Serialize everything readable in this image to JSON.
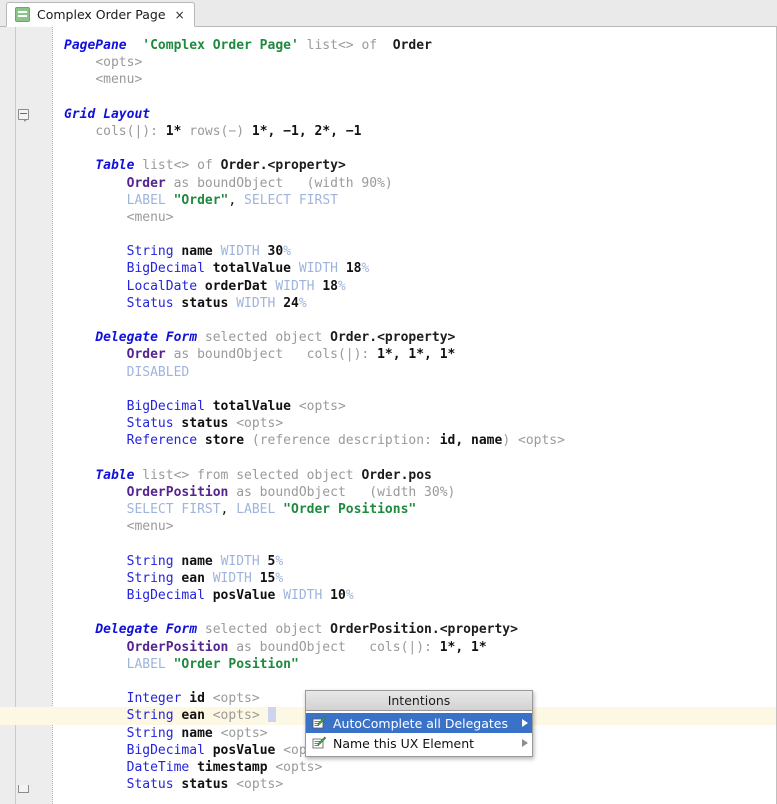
{
  "tab": {
    "icon": "page-green-icon",
    "label": "Complex Order Page",
    "close": "×"
  },
  "code": {
    "lines": [
      {
        "indent": 0,
        "tokens": [
          {
            "c": "t-elem",
            "t": "PagePane"
          },
          {
            "c": "t-plain",
            "t": "  "
          },
          {
            "c": "t-str",
            "t": "'Complex Order Page'"
          },
          {
            "c": "t-plain",
            "t": " "
          },
          {
            "c": "t-dim",
            "t": "list<> of"
          },
          {
            "c": "t-plain",
            "t": "  "
          },
          {
            "c": "t-key",
            "t": "Order"
          }
        ]
      },
      {
        "indent": 1,
        "tokens": [
          {
            "c": "t-dim",
            "t": "<opts>"
          }
        ]
      },
      {
        "indent": 1,
        "tokens": [
          {
            "c": "t-dim",
            "t": "<menu>"
          }
        ]
      },
      {
        "indent": 0,
        "tokens": []
      },
      {
        "indent": 0,
        "fold": "open",
        "tokens": [
          {
            "c": "t-elem",
            "t": "Grid Layout"
          }
        ]
      },
      {
        "indent": 1,
        "tokens": [
          {
            "c": "t-dim",
            "t": "cols(|): "
          },
          {
            "c": "t-num",
            "t": "1*"
          },
          {
            "c": "t-dim",
            "t": " rows(−) "
          },
          {
            "c": "t-num",
            "t": "1*, −1, 2*, −1"
          }
        ]
      },
      {
        "indent": 0,
        "tokens": []
      },
      {
        "indent": 1,
        "tokens": [
          {
            "c": "t-elem",
            "t": "Table"
          },
          {
            "c": "t-plain",
            "t": " "
          },
          {
            "c": "t-dim",
            "t": "list<> of "
          },
          {
            "c": "t-key",
            "t": "Order.<property>"
          }
        ]
      },
      {
        "indent": 2,
        "tokens": [
          {
            "c": "t-cls",
            "t": "Order"
          },
          {
            "c": "t-plain",
            "t": " "
          },
          {
            "c": "t-dim",
            "t": "as boundObject   (width 90%)"
          }
        ]
      },
      {
        "indent": 2,
        "tokens": [
          {
            "c": "t-kw",
            "t": "LABEL "
          },
          {
            "c": "t-str",
            "t": "\"Order\""
          },
          {
            "c": "t-plain",
            "t": ", "
          },
          {
            "c": "t-kw",
            "t": "SELECT FIRST"
          }
        ]
      },
      {
        "indent": 2,
        "tokens": [
          {
            "c": "t-dim",
            "t": "<menu>"
          }
        ]
      },
      {
        "indent": 0,
        "tokens": []
      },
      {
        "indent": 2,
        "tokens": [
          {
            "c": "t-type",
            "t": "String"
          },
          {
            "c": "t-plain",
            "t": " "
          },
          {
            "c": "t-prop",
            "t": "name"
          },
          {
            "c": "t-plain",
            "t": " "
          },
          {
            "c": "t-kw",
            "t": "WIDTH"
          },
          {
            "c": "t-plain",
            "t": " "
          },
          {
            "c": "t-num",
            "t": "30"
          },
          {
            "c": "t-kw",
            "t": "%"
          }
        ]
      },
      {
        "indent": 2,
        "tokens": [
          {
            "c": "t-type",
            "t": "BigDecimal"
          },
          {
            "c": "t-plain",
            "t": " "
          },
          {
            "c": "t-prop",
            "t": "totalValue"
          },
          {
            "c": "t-plain",
            "t": " "
          },
          {
            "c": "t-kw",
            "t": "WIDTH"
          },
          {
            "c": "t-plain",
            "t": " "
          },
          {
            "c": "t-num",
            "t": "18"
          },
          {
            "c": "t-kw",
            "t": "%"
          }
        ]
      },
      {
        "indent": 2,
        "tokens": [
          {
            "c": "t-type",
            "t": "LocalDate"
          },
          {
            "c": "t-plain",
            "t": " "
          },
          {
            "c": "t-prop",
            "t": "orderDat"
          },
          {
            "c": "t-plain",
            "t": " "
          },
          {
            "c": "t-kw",
            "t": "WIDTH"
          },
          {
            "c": "t-plain",
            "t": " "
          },
          {
            "c": "t-num",
            "t": "18"
          },
          {
            "c": "t-kw",
            "t": "%"
          }
        ]
      },
      {
        "indent": 2,
        "tokens": [
          {
            "c": "t-type",
            "t": "Status"
          },
          {
            "c": "t-plain",
            "t": " "
          },
          {
            "c": "t-prop",
            "t": "status"
          },
          {
            "c": "t-plain",
            "t": " "
          },
          {
            "c": "t-kw",
            "t": "WIDTH"
          },
          {
            "c": "t-plain",
            "t": " "
          },
          {
            "c": "t-num",
            "t": "24"
          },
          {
            "c": "t-kw",
            "t": "%"
          }
        ]
      },
      {
        "indent": 0,
        "tokens": []
      },
      {
        "indent": 1,
        "tokens": [
          {
            "c": "t-elem",
            "t": "Delegate Form"
          },
          {
            "c": "t-plain",
            "t": " "
          },
          {
            "c": "t-dim",
            "t": "selected object "
          },
          {
            "c": "t-key",
            "t": "Order.<property>"
          }
        ]
      },
      {
        "indent": 2,
        "tokens": [
          {
            "c": "t-cls",
            "t": "Order"
          },
          {
            "c": "t-plain",
            "t": " "
          },
          {
            "c": "t-dim",
            "t": "as boundObject   cols(|): "
          },
          {
            "c": "t-num",
            "t": "1*, 1*, 1*"
          }
        ]
      },
      {
        "indent": 2,
        "tokens": [
          {
            "c": "t-kw",
            "t": "DISABLED"
          }
        ]
      },
      {
        "indent": 0,
        "tokens": []
      },
      {
        "indent": 2,
        "tokens": [
          {
            "c": "t-type",
            "t": "BigDecimal"
          },
          {
            "c": "t-plain",
            "t": " "
          },
          {
            "c": "t-prop",
            "t": "totalValue"
          },
          {
            "c": "t-plain",
            "t": " "
          },
          {
            "c": "t-dim",
            "t": "<opts>"
          }
        ]
      },
      {
        "indent": 2,
        "tokens": [
          {
            "c": "t-type",
            "t": "Status"
          },
          {
            "c": "t-plain",
            "t": " "
          },
          {
            "c": "t-prop",
            "t": "status"
          },
          {
            "c": "t-plain",
            "t": " "
          },
          {
            "c": "t-dim",
            "t": "<opts>"
          }
        ]
      },
      {
        "indent": 2,
        "tokens": [
          {
            "c": "t-type",
            "t": "Reference"
          },
          {
            "c": "t-plain",
            "t": " "
          },
          {
            "c": "t-prop",
            "t": "store"
          },
          {
            "c": "t-plain",
            "t": " "
          },
          {
            "c": "t-dim",
            "t": "(reference description: "
          },
          {
            "c": "t-prop",
            "t": "id, name"
          },
          {
            "c": "t-dim",
            "t": ") <opts>"
          }
        ]
      },
      {
        "indent": 0,
        "tokens": []
      },
      {
        "indent": 1,
        "tokens": [
          {
            "c": "t-elem",
            "t": "Table"
          },
          {
            "c": "t-plain",
            "t": " "
          },
          {
            "c": "t-dim",
            "t": "list<> from selected object "
          },
          {
            "c": "t-key",
            "t": "Order.pos"
          }
        ]
      },
      {
        "indent": 2,
        "tokens": [
          {
            "c": "t-cls",
            "t": "OrderPosition"
          },
          {
            "c": "t-plain",
            "t": " "
          },
          {
            "c": "t-dim",
            "t": "as boundObject   (width 30%)"
          }
        ]
      },
      {
        "indent": 2,
        "tokens": [
          {
            "c": "t-kw",
            "t": "SELECT FIRST"
          },
          {
            "c": "t-plain",
            "t": ", "
          },
          {
            "c": "t-kw",
            "t": "LABEL "
          },
          {
            "c": "t-str",
            "t": "\"Order Positions\""
          }
        ]
      },
      {
        "indent": 2,
        "tokens": [
          {
            "c": "t-dim",
            "t": "<menu>"
          }
        ]
      },
      {
        "indent": 0,
        "tokens": []
      },
      {
        "indent": 2,
        "tokens": [
          {
            "c": "t-type",
            "t": "String"
          },
          {
            "c": "t-plain",
            "t": " "
          },
          {
            "c": "t-prop",
            "t": "name"
          },
          {
            "c": "t-plain",
            "t": " "
          },
          {
            "c": "t-kw",
            "t": "WIDTH"
          },
          {
            "c": "t-plain",
            "t": " "
          },
          {
            "c": "t-num",
            "t": "5"
          },
          {
            "c": "t-kw",
            "t": "%"
          }
        ]
      },
      {
        "indent": 2,
        "tokens": [
          {
            "c": "t-type",
            "t": "String"
          },
          {
            "c": "t-plain",
            "t": " "
          },
          {
            "c": "t-prop",
            "t": "ean"
          },
          {
            "c": "t-plain",
            "t": " "
          },
          {
            "c": "t-kw",
            "t": "WIDTH"
          },
          {
            "c": "t-plain",
            "t": " "
          },
          {
            "c": "t-num",
            "t": "15"
          },
          {
            "c": "t-kw",
            "t": "%"
          }
        ]
      },
      {
        "indent": 2,
        "tokens": [
          {
            "c": "t-type",
            "t": "BigDecimal"
          },
          {
            "c": "t-plain",
            "t": " "
          },
          {
            "c": "t-prop",
            "t": "posValue"
          },
          {
            "c": "t-plain",
            "t": " "
          },
          {
            "c": "t-kw",
            "t": "WIDTH"
          },
          {
            "c": "t-plain",
            "t": " "
          },
          {
            "c": "t-num",
            "t": "10"
          },
          {
            "c": "t-kw",
            "t": "%"
          }
        ]
      },
      {
        "indent": 0,
        "tokens": []
      },
      {
        "indent": 1,
        "tokens": [
          {
            "c": "t-elem",
            "t": "Delegate Form"
          },
          {
            "c": "t-plain",
            "t": " "
          },
          {
            "c": "t-dim",
            "t": "selected object "
          },
          {
            "c": "t-key",
            "t": "OrderPosition.<property>"
          }
        ]
      },
      {
        "indent": 2,
        "tokens": [
          {
            "c": "t-cls",
            "t": "OrderPosition"
          },
          {
            "c": "t-plain",
            "t": " "
          },
          {
            "c": "t-dim",
            "t": "as boundObject   cols(|): "
          },
          {
            "c": "t-num",
            "t": "1*, 1*"
          }
        ]
      },
      {
        "indent": 2,
        "tokens": [
          {
            "c": "t-kw",
            "t": "LABEL "
          },
          {
            "c": "t-str",
            "t": "\"Order Position\""
          }
        ]
      },
      {
        "indent": 0,
        "tokens": []
      },
      {
        "indent": 2,
        "tokens": [
          {
            "c": "t-type",
            "t": "Integer"
          },
          {
            "c": "t-plain",
            "t": " "
          },
          {
            "c": "t-prop",
            "t": "id"
          },
          {
            "c": "t-plain",
            "t": " "
          },
          {
            "c": "t-dim",
            "t": "<opts>"
          }
        ]
      },
      {
        "indent": 2,
        "highlight": true,
        "bulb": true,
        "caret": true,
        "tokens": [
          {
            "c": "t-type",
            "t": "String"
          },
          {
            "c": "t-plain",
            "t": " "
          },
          {
            "c": "t-prop",
            "t": "ean"
          },
          {
            "c": "t-plain",
            "t": " "
          },
          {
            "c": "t-dim",
            "t": "<opts>"
          },
          {
            "c": "t-plain",
            "t": " "
          }
        ]
      },
      {
        "indent": 2,
        "tokens": [
          {
            "c": "t-type",
            "t": "String"
          },
          {
            "c": "t-plain",
            "t": " "
          },
          {
            "c": "t-prop",
            "t": "name"
          },
          {
            "c": "t-plain",
            "t": " "
          },
          {
            "c": "t-dim",
            "t": "<opts>"
          }
        ]
      },
      {
        "indent": 2,
        "tokens": [
          {
            "c": "t-type",
            "t": "BigDecimal"
          },
          {
            "c": "t-plain",
            "t": " "
          },
          {
            "c": "t-prop",
            "t": "posValue"
          },
          {
            "c": "t-plain",
            "t": " "
          },
          {
            "c": "t-dim",
            "t": "<opts>"
          }
        ]
      },
      {
        "indent": 2,
        "tokens": [
          {
            "c": "t-type",
            "t": "DateTime"
          },
          {
            "c": "t-plain",
            "t": " "
          },
          {
            "c": "t-prop",
            "t": "timestamp"
          },
          {
            "c": "t-plain",
            "t": " "
          },
          {
            "c": "t-dim",
            "t": "<opts>"
          }
        ]
      },
      {
        "indent": 2,
        "fold_end": true,
        "tokens": [
          {
            "c": "t-type",
            "t": "Status"
          },
          {
            "c": "t-plain",
            "t": " "
          },
          {
            "c": "t-prop",
            "t": "status"
          },
          {
            "c": "t-plain",
            "t": " "
          },
          {
            "c": "t-dim",
            "t": "<opts>"
          }
        ]
      }
    ]
  },
  "intentions": {
    "title": "Intentions",
    "items": [
      {
        "icon": "edit-pencil-icon",
        "label": "AutoComplete all Delegates",
        "selected": true,
        "has_submenu": true
      },
      {
        "icon": "edit-pencil-icon",
        "label": "Name this UX Element",
        "selected": false,
        "has_submenu": true
      }
    ]
  },
  "colors": {
    "element": "#1111dd",
    "string": "#1f8a3f",
    "type": "#2424dd",
    "class": "#54258e",
    "keyword": "#9fb4dd",
    "dim": "#9a9a9a",
    "selection": "#3a72c8",
    "highlight_line": "#fdf8e3",
    "tab_icon": "#8bc48b"
  }
}
